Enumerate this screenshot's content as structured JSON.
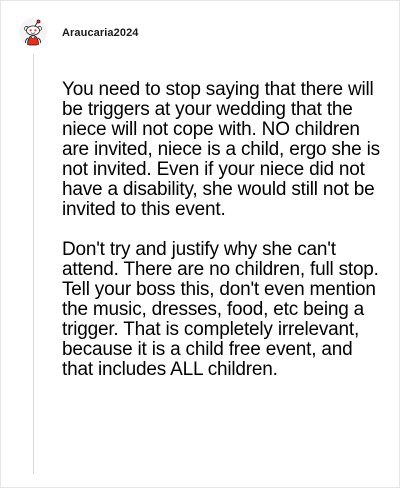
{
  "comment": {
    "author": {
      "username": "Araucaria2024",
      "avatar_icon": "reddit-snoo-avatar-icon",
      "avatar_colors": {
        "background": "#ffffff",
        "body": "#ffffff",
        "accent": "#e0301e",
        "outline": "#1a1a1b"
      }
    },
    "paragraphs": [
      "You need to stop saying that there will be triggers at your wedding that the niece will not cope with. NO children are invited, niece is a child, ergo she is not invited. Even if your niece did not have a disability, she would still not be invited to this event.",
      "Don't try and justify why she can't attend. There are no children, full stop. Tell your boss this, don't even mention the music, dresses, food, etc being a trigger. That is completely irrelevant, because it is a child free event, and that includes ALL children."
    ]
  }
}
